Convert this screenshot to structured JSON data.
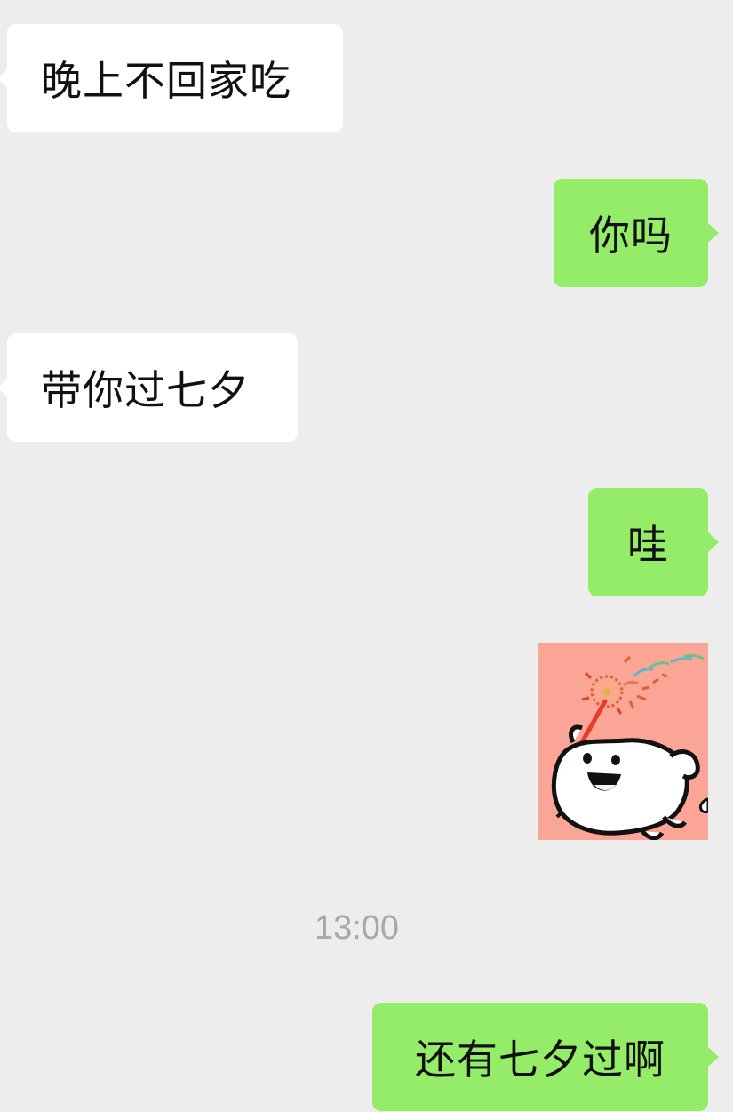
{
  "chat": {
    "messages": [
      {
        "side": "left",
        "text": "晚上不回家吃"
      },
      {
        "side": "right",
        "text": "你吗"
      },
      {
        "side": "left",
        "text": "带你过七夕"
      },
      {
        "side": "right",
        "text": "哇"
      },
      {
        "side": "right",
        "type": "sticker",
        "icon": "cartoon-dog-sparkler-sticker"
      },
      {
        "side": "right",
        "text": "还有七夕过啊"
      }
    ],
    "timestamp": "13:00"
  },
  "colors": {
    "background": "#ededed",
    "incoming_bubble": "#ffffff",
    "outgoing_bubble": "#95ec69",
    "timestamp_text": "#a8a8a8",
    "sticker_background": "#fba596"
  }
}
